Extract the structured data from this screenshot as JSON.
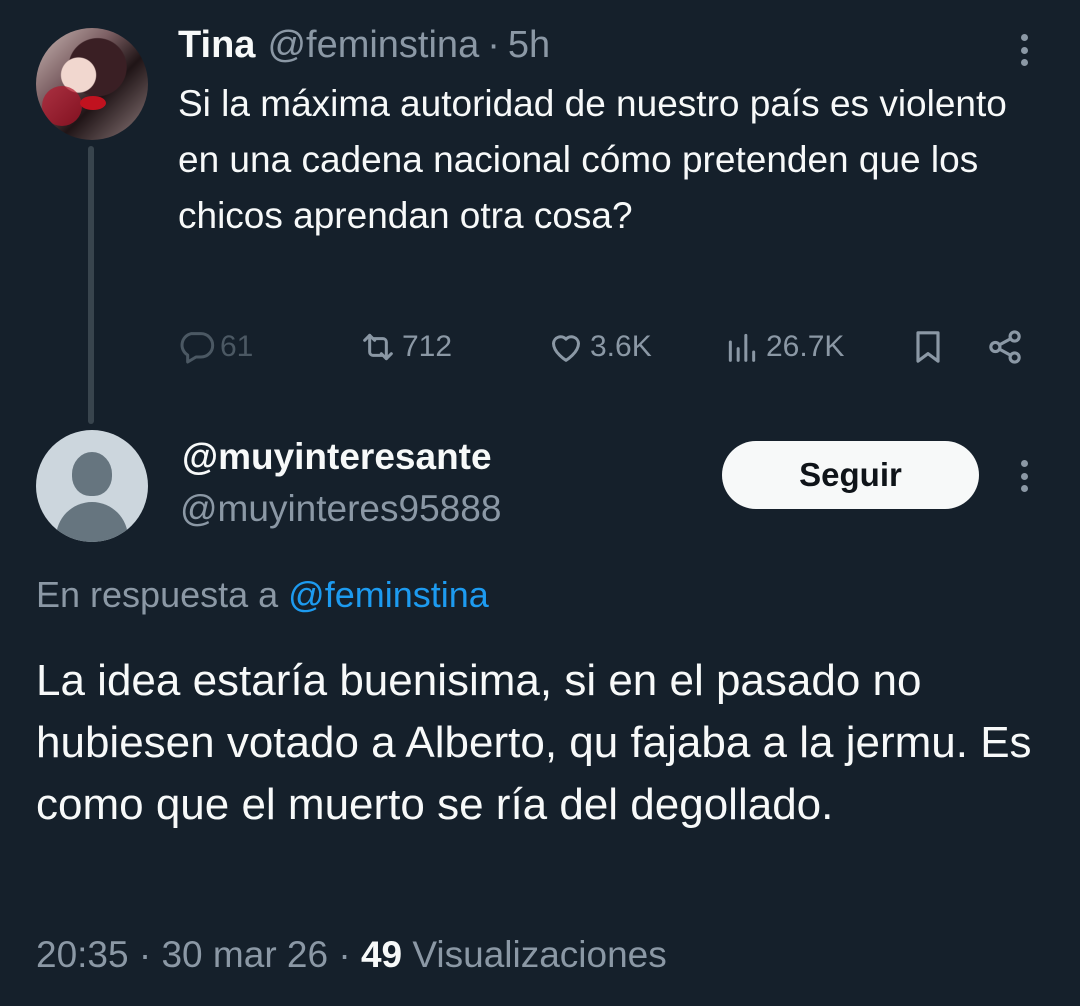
{
  "parent_tweet": {
    "display_name": "Tina",
    "handle": "@feminstina",
    "separator": "·",
    "time_ago": "5h",
    "text": "Si la máxima autoridad de nuestro país es violento en una cadena nacional cómo pretenden que los chicos aprendan otra cosa?",
    "stats": {
      "replies": "61",
      "retweets": "712",
      "likes": "3.6K",
      "views": "26.7K"
    }
  },
  "reply_tweet": {
    "display_name": "@muyinteresante",
    "handle": "@muyinteres95888",
    "follow_label": "Seguir",
    "replying_to_prefix": "En respuesta a",
    "replying_to_handle": "@feminstina",
    "text": "La idea estaría buenisima, si en el pasado no hubiesen votado a Alberto, qu fajaba a la jermu. Es como que el muerto se ría del degollado.",
    "time": "20:35",
    "date": "30 mar 26",
    "separator": "·",
    "views_count": "49",
    "views_label": "Visualizaciones"
  },
  "icons": [
    "more-vertical-icon",
    "reply-icon",
    "retweet-icon",
    "like-icon",
    "views-icon",
    "bookmark-icon",
    "share-icon"
  ],
  "colors": {
    "background": "#15202b",
    "text_primary": "#f7f9f9",
    "text_muted": "#8b98a5",
    "link": "#1d9bf0",
    "thread_line": "#38444d"
  }
}
